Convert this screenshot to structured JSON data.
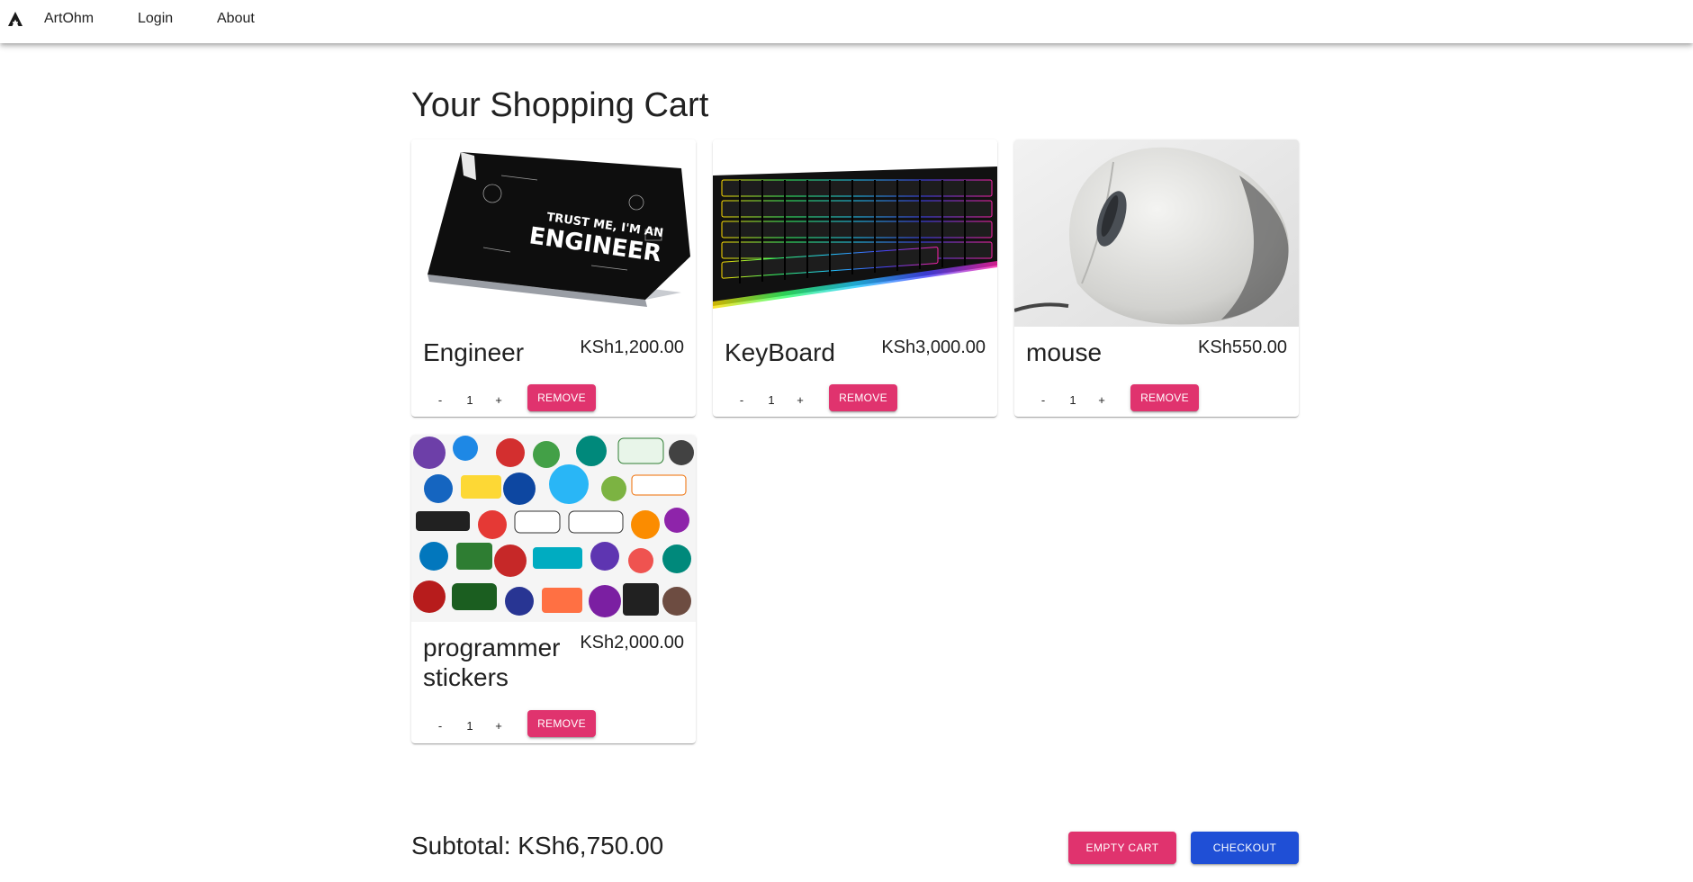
{
  "nav": {
    "brand": "ArtOhm",
    "login": "Login",
    "about": "About"
  },
  "page": {
    "title": "Your Shopping Cart"
  },
  "cart": {
    "items": [
      {
        "name": "Engineer",
        "price": "KSh1,200.00",
        "quantity": "1",
        "minus": "-",
        "plus": "+",
        "remove": "REMOVE",
        "image": "laptop-skin-image"
      },
      {
        "name": "KeyBoard",
        "price": "KSh3,000.00",
        "quantity": "1",
        "minus": "-",
        "plus": "+",
        "remove": "REMOVE",
        "image": "keyboard-image"
      },
      {
        "name": "mouse",
        "price": "KSh550.00",
        "quantity": "1",
        "minus": "-",
        "plus": "+",
        "remove": "REMOVE",
        "image": "mouse-image"
      },
      {
        "name": "programmer stickers",
        "price": "KSh2,000.00",
        "quantity": "1",
        "minus": "-",
        "plus": "+",
        "remove": "REMOVE",
        "image": "stickers-image"
      }
    ],
    "subtotal": "Subtotal: KSh6,750.00",
    "empty_label": "EMPTY CART",
    "checkout_label": "CHECKOUT"
  },
  "colors": {
    "remove": "#e0336e",
    "checkout": "#1f4fd6"
  }
}
